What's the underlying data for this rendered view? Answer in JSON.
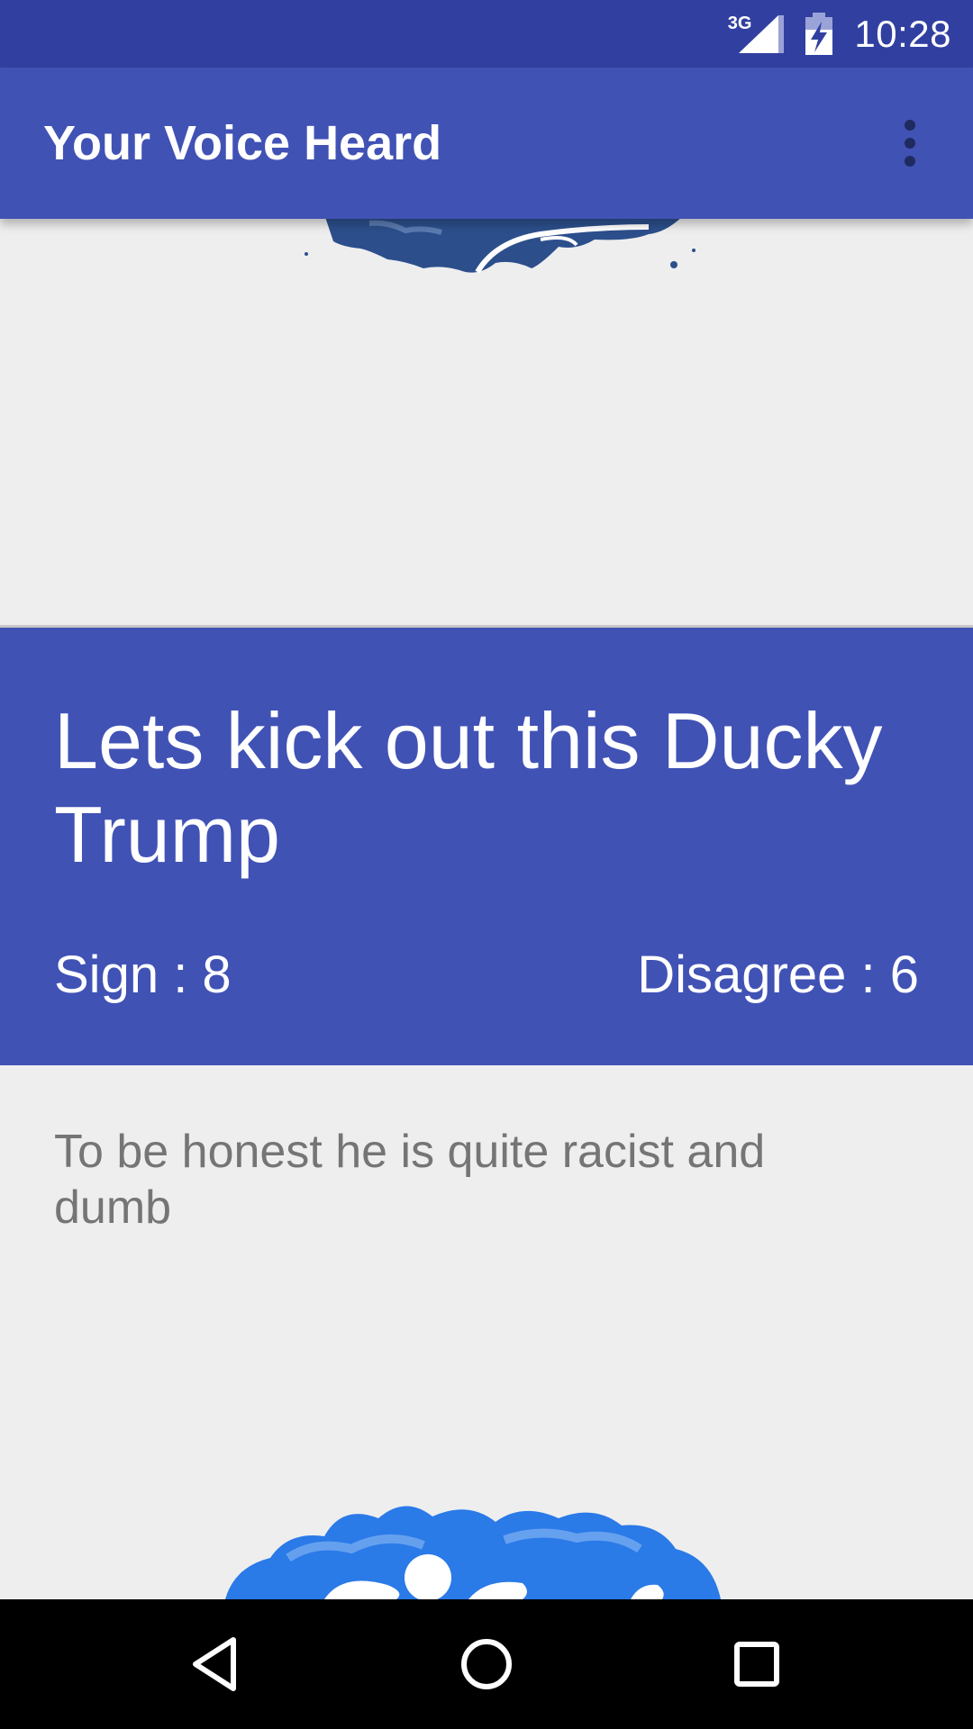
{
  "status_bar": {
    "network": "3G",
    "time": "10:28"
  },
  "app_bar": {
    "title": "Your Voice Heard",
    "overflow_icon": "more-vert-icon"
  },
  "petition": {
    "title": "Lets kick out this Ducky Trump",
    "sign_label": "Sign : 8",
    "disagree_label": "Disagree : 6",
    "description": "To be honest he is quite racist and dumb"
  },
  "colors": {
    "status_bar": "#3140a0",
    "primary": "#4152b5",
    "background": "#eeeeee",
    "description_text": "#757575",
    "splash_dark": "#2c4f8c",
    "splash_light": "#2a7ae8"
  },
  "nav_bar": {
    "back_icon": "back-triangle-icon",
    "home_icon": "home-circle-icon",
    "recents_icon": "recents-square-icon"
  }
}
